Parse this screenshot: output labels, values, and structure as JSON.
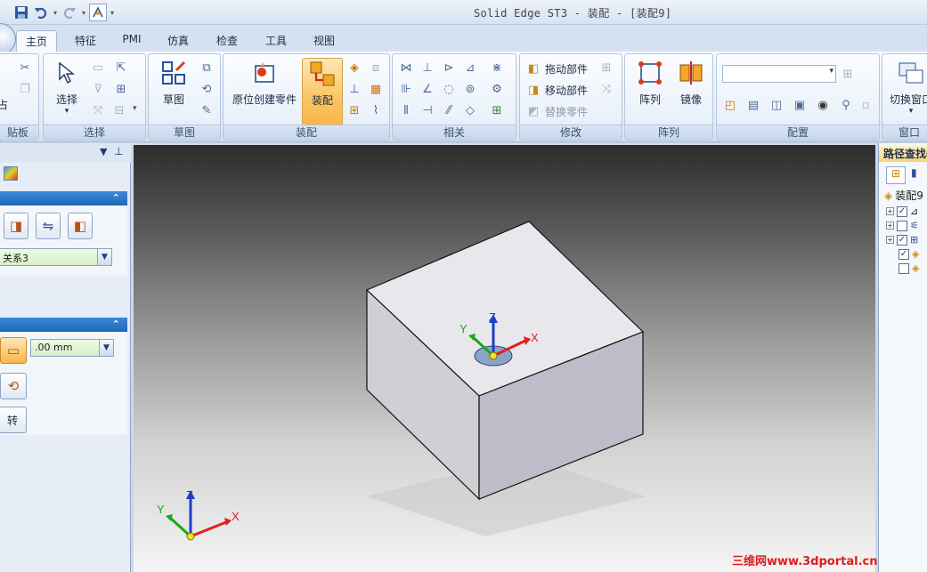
{
  "window": {
    "title": "Solid Edge ST3 - 装配 - [装配9]"
  },
  "quick_access": {
    "icons": [
      "save-icon",
      "undo-icon",
      "redo-icon",
      "assembly-icon",
      "customize-icon"
    ]
  },
  "tabs": [
    {
      "label": "主页",
      "active": true
    },
    {
      "label": "特征"
    },
    {
      "label": "PMI"
    },
    {
      "label": "仿真"
    },
    {
      "label": "检查"
    },
    {
      "label": "工具"
    },
    {
      "label": "视图"
    }
  ],
  "ribbon": {
    "groups": {
      "clipboard": {
        "label": "贴板",
        "paste_label": "占"
      },
      "select": {
        "label": "选择",
        "select_label": "选择"
      },
      "sketch": {
        "label": "草图",
        "sketch_label": "草图"
      },
      "assemble": {
        "label": "装配",
        "create_inplace_label": "原位创建零件",
        "assemble_label": "装配"
      },
      "relate": {
        "label": "相关"
      },
      "modify": {
        "label": "修改",
        "drag_label": "拖动部件",
        "move_label": "移动部件",
        "replace_label": "替换零件"
      },
      "pattern": {
        "label": "阵列",
        "pattern_label": "阵列",
        "mirror_label": "镜像"
      },
      "configure": {
        "label": "配置",
        "combo_value": ""
      },
      "window": {
        "label": "窗口",
        "switch_label": "切换窗口"
      }
    }
  },
  "left_panel": {
    "relation_combo": "关系3",
    "offset_combo": ".00 mm",
    "rotate_label": "转"
  },
  "right_panel": {
    "header": "路径查找器",
    "root": "装配9"
  },
  "watermark": "三维网www.3dportal.cn",
  "colors": {
    "accent": "#1f67b8",
    "active_button": "#fbc866",
    "x_axis": "#e02020",
    "y_axis": "#18a818",
    "z_axis": "#1c3fc8"
  }
}
